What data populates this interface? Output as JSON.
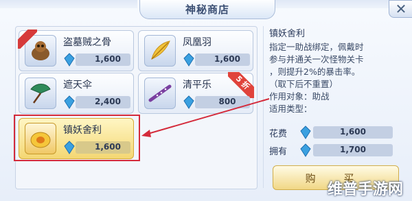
{
  "window": {
    "title": "神秘商店",
    "close_icon": "close-icon",
    "close_glyph": "✕"
  },
  "items": [
    {
      "name": "盗墓贼之骨",
      "price": "1,600",
      "icon": "bone-creature-icon",
      "badge": "ribbon"
    },
    {
      "name": "凤凰羽",
      "price": "1,600",
      "icon": "phoenix-feather-icon"
    },
    {
      "name": "遮天伞",
      "price": "2,400",
      "icon": "umbrella-icon"
    },
    {
      "name": "清平乐",
      "price": "800",
      "icon": "flute-icon",
      "sale": "5 折"
    },
    {
      "name": "镇妖舍利",
      "price": "1,600",
      "icon": "relic-icon",
      "selected": true
    }
  ],
  "detail": {
    "title": "镇妖舍利",
    "desc_lines": [
      "指定一助战绑定，佩戴时",
      "参与并通关一次怪物关卡",
      "，则提升2%的暴击率。",
      "（取下后不重置）",
      "作用对象：助战",
      "适用类型："
    ]
  },
  "stats": {
    "cost_label": "花费",
    "cost_value": "1,600",
    "owned_label": "拥有",
    "owned_value": "1,700"
  },
  "buy_label": "购 买",
  "watermark": "维普手游网",
  "colors": {
    "highlight": "#d42a3a",
    "sale": "#e0433b",
    "currency": "#3aa0e0"
  }
}
